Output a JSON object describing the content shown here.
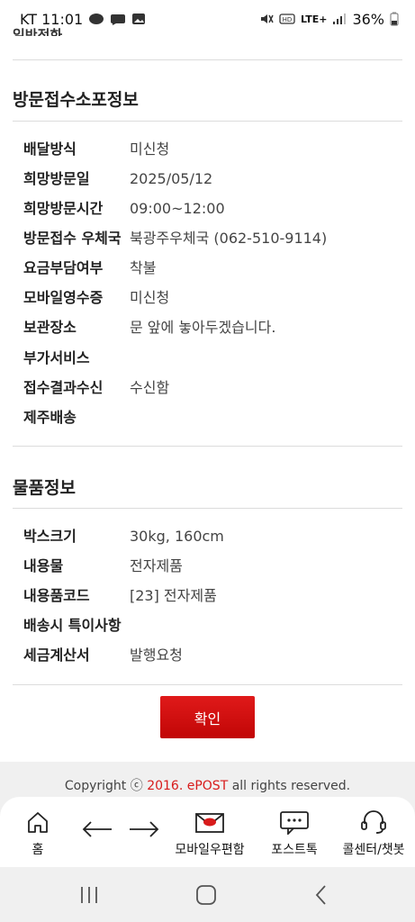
{
  "status_bar": {
    "carrier_time": "KT 11:01",
    "network": "LTE+",
    "battery": "36%",
    "icons": [
      "talk-icon",
      "chat-bubble-icon",
      "gallery-icon",
      "mute-icon",
      "hd-icon",
      "signal-icon",
      "battery-icon"
    ]
  },
  "top_cut_text": "일반전화",
  "visit_section": {
    "title": "방문접수소포정보",
    "rows": [
      {
        "label": "배달방식",
        "value": "미신청"
      },
      {
        "label": "희망방문일",
        "value": "2025/05/12"
      },
      {
        "label": "희망방문시간",
        "value": "09:00~12:00"
      },
      {
        "label": "방문접수 우체국",
        "value": "북광주우체국 (062-510-9114)"
      },
      {
        "label": "요금부담여부",
        "value": "착불"
      },
      {
        "label": "모바일영수증",
        "value": "미신청"
      },
      {
        "label": "보관장소",
        "value": "문 앞에 놓아두겠습니다."
      },
      {
        "label": "부가서비스",
        "value": ""
      },
      {
        "label": "접수결과수신",
        "value": "수신함"
      },
      {
        "label": "제주배송",
        "value": ""
      }
    ]
  },
  "item_section": {
    "title": "물품정보",
    "rows": [
      {
        "label": "박스크기",
        "value": "30kg, 160cm"
      },
      {
        "label": "내용물",
        "value": "전자제품"
      },
      {
        "label": "내용품코드",
        "value": "[23] 전자제품"
      },
      {
        "label": "배송시 특이사항",
        "value": ""
      },
      {
        "label": "세금계산서",
        "value": "발행요청"
      }
    ]
  },
  "confirm_label": "확인",
  "copyright": {
    "prefix": "Copyright ⓒ ",
    "year": "2016.",
    "brand": "ePOST",
    "suffix": " all rights reserved."
  },
  "bottom_nav": {
    "home": "홈",
    "mailbox": "모바일우편함",
    "posttalk": "포스트톡",
    "callcenter": "콜센터/챗봇"
  },
  "colors": {
    "accent": "#d81b1b",
    "footer_bg": "#f0f0f0",
    "divider": "#dcdcdc"
  }
}
